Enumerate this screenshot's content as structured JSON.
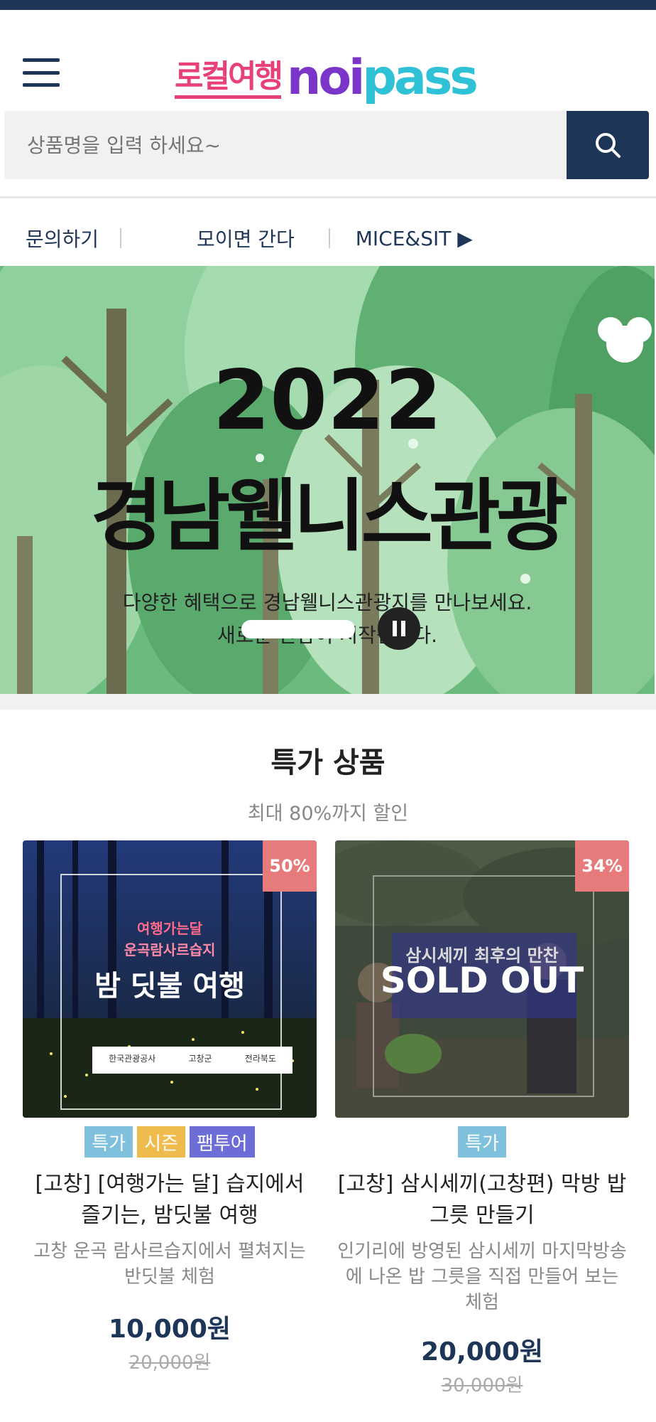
{
  "header": {
    "logo_kr": "로컬여행",
    "logo_noi": "noi",
    "logo_pass": "pass"
  },
  "search": {
    "placeholder": "상품명을 입력 하세요~"
  },
  "nav": {
    "items": [
      "문의하기",
      "모이면 간다",
      "MICE&SIT ▶"
    ]
  },
  "banner": {
    "year": "2022",
    "title": "경남웰니스관광",
    "subtitle1": "다양한 혜택으로 경남웰니스관광지를 만나보세요.",
    "subtitle2": "새로운 만남이 시작됩니다."
  },
  "section": {
    "title": "특가 상품",
    "subtitle": "최대 80%까지 할인"
  },
  "products": [
    {
      "discount": "50%",
      "thumb_caption_small": "여행가는달",
      "thumb_caption_mid": "운곡람사르습지",
      "thumb_caption_big": "밤 딧불 여행",
      "logos": [
        "한국관광공사",
        "고창군",
        "전라북도"
      ],
      "tags": [
        "특가",
        "시즌",
        "팸투어"
      ],
      "title": "[고창] [여행가는 달] 습지에서 즐기는, 밤딧불 여행",
      "desc": "고창 운곡 람사르습지에서 펼쳐지는 반딧불 체험",
      "price": "10,000원",
      "original_price": "20,000원"
    },
    {
      "discount": "34%",
      "thumb_caption_big": "삼시세끼 최후의 만찬",
      "sold_out": "SOLD OUT",
      "tags": [
        "특가"
      ],
      "title": "[고창] 삼시세끼(고창편) 막방 밥그릇 만들기",
      "desc": "인기리에 방영된 삼시세끼 마지막방송에 나온 밥 그릇을 직접 만들어 보는 체험",
      "price": "20,000원",
      "original_price": "30,000원"
    }
  ],
  "colors": {
    "navy": "#1d3557",
    "pink": "#e8407a",
    "purple": "#7b35c9",
    "cyan": "#2fc1d5",
    "discount": "#e77b7b"
  }
}
